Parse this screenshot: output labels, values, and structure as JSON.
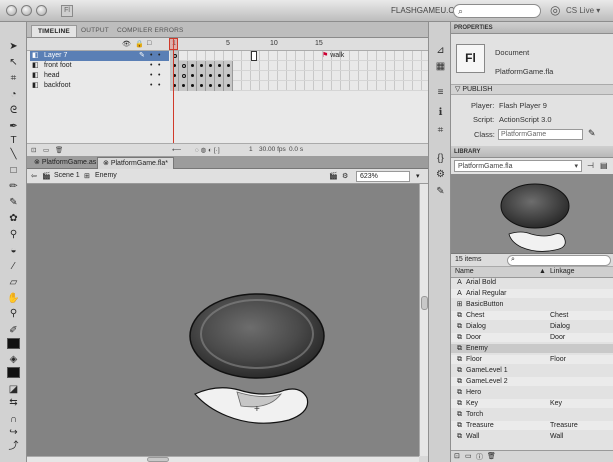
{
  "titlebar": {
    "workspace": "FLASHGAMEU.COM ▾",
    "search_placeholder": "",
    "cslive": "CS Live ▾",
    "app_badge": "Fl"
  },
  "panel_tabs": [
    "TIMELINE",
    "OUTPUT",
    "COMPILER ERRORS"
  ],
  "timeline": {
    "frame_numbers": [
      "1",
      "5",
      "10",
      "15"
    ],
    "frame_label": "walk",
    "layers": [
      {
        "name": "Layer 7",
        "selected": true
      },
      {
        "name": "front foot",
        "selected": false
      },
      {
        "name": "head",
        "selected": false
      },
      {
        "name": "backfoot",
        "selected": false
      }
    ],
    "footer_fps": "30.00 fps",
    "footer_time": "0.0 s",
    "footer_frame": "1"
  },
  "document_tabs": [
    "PlatformGame.as",
    "PlatformGame.fla*"
  ],
  "editbar": {
    "scene": "Scene 1",
    "symbol": "Enemy",
    "zoom": "623%"
  },
  "properties": {
    "header": "PROPERTIES",
    "type": "Document",
    "filename": "PlatformGame.fla",
    "publish_header": "PUBLISH",
    "player_label": "Player:",
    "player_value": "Flash Player 9",
    "script_label": "Script:",
    "script_value": "ActionScript 3.0",
    "class_label": "Class:",
    "class_value": "PlatformGame"
  },
  "library": {
    "header": "LIBRARY",
    "file": "PlatformGame.fla",
    "count": "15 items",
    "col_name": "Name",
    "col_linkage": "Linkage",
    "items": [
      {
        "icon": "font",
        "name": "Arial Bold",
        "linkage": ""
      },
      {
        "icon": "font",
        "name": "Arial Regular",
        "linkage": ""
      },
      {
        "icon": "button",
        "name": "BasicButton",
        "linkage": ""
      },
      {
        "icon": "movieclip",
        "name": "Chest",
        "linkage": "Chest"
      },
      {
        "icon": "movieclip",
        "name": "Dialog",
        "linkage": "Dialog"
      },
      {
        "icon": "movieclip",
        "name": "Door",
        "linkage": "Door"
      },
      {
        "icon": "movieclip",
        "name": "Enemy",
        "linkage": "",
        "selected": true
      },
      {
        "icon": "movieclip",
        "name": "Floor",
        "linkage": "Floor"
      },
      {
        "icon": "movieclip",
        "name": "GameLevel 1",
        "linkage": ""
      },
      {
        "icon": "movieclip",
        "name": "GameLevel 2",
        "linkage": ""
      },
      {
        "icon": "movieclip",
        "name": "Hero",
        "linkage": ""
      },
      {
        "icon": "movieclip",
        "name": "Key",
        "linkage": "Key"
      },
      {
        "icon": "movieclip",
        "name": "Torch",
        "linkage": ""
      },
      {
        "icon": "movieclip",
        "name": "Treasure",
        "linkage": "Treasure"
      },
      {
        "icon": "movieclip",
        "name": "Wall",
        "linkage": "Wall"
      }
    ]
  },
  "colors": {
    "selection": "#5a7fb5",
    "stage": "#838383",
    "playhead": "#d03a2a"
  }
}
